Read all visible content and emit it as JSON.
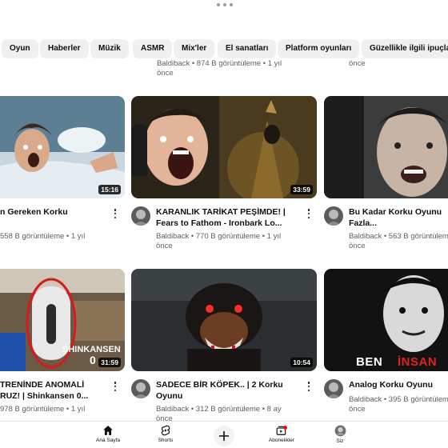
{
  "chips": [
    "Oyun",
    "Haberler",
    "Müzik",
    "ASMR",
    "Mix'ler",
    "El sanatları",
    "Platform oyunları",
    "Güzellikle ilgili ipuçla"
  ],
  "prev_row": {
    "middle_meta_1": "Baldiback • 874 B görüntüleme • 1 yıl",
    "middle_meta_2": "önce",
    "right_meta": "önce"
  },
  "videos": [
    {
      "title_lines": [
        "n Gereken Korku",
        ""
      ],
      "meta_lines": [
        "558 B görüntüleme • 1 yıl",
        ""
      ],
      "duration": "15:16"
    },
    {
      "title_lines": [
        "KARANLIK TARİKAT PEŞİMDE! |",
        "Fears to Fathom - Ironbark Lo..."
      ],
      "meta_lines": [
        "Baldiback • 770 B görüntüleme • 1 yıl",
        "önce"
      ],
      "duration": "33:59"
    },
    {
      "title_lines": [
        "Bu Kadar Korku Oyunu",
        "Fazla..."
      ],
      "meta_lines": [
        "Baldiback • 563 B görüntüleme",
        "önce"
      ],
      "duration": ""
    },
    {
      "title_lines": [
        "TRENİNDE ANOMALİ",
        "RUZ! | Shinkansen 0..."
      ],
      "meta_lines": [
        "978 B görüntüleme • 1 yıl",
        ""
      ],
      "duration": "31:59",
      "thumb_text": [
        "SHINKANSEN",
        "0"
      ]
    },
    {
      "title_lines": [
        "SADECE BİR KÖPEK.. | 2 Korku",
        "Oyunu"
      ],
      "meta_lines": [
        "Baldiback • 312 B görüntüleme • 8 ay",
        "önce"
      ],
      "duration": "10:54"
    },
    {
      "title_lines": [
        "Analog Korku Oyunu",
        ""
      ],
      "meta_lines": [
        "Baldiback • 395 B görüntüleme",
        "önce"
      ],
      "duration": "",
      "thumb_text": [
        "BEN",
        "İNSAN"
      ]
    }
  ],
  "nav": {
    "home": "Ana Sayfa",
    "shorts": "Shorts",
    "subscriptions": "Abonelikler",
    "you": "Siz"
  },
  "colors": {
    "chip_bg": "#f0f0f0",
    "meta_text": "#606060",
    "notification_dot": "#ff0000",
    "thumb_red_text": "#e0231f"
  },
  "icons": [
    "home-icon",
    "shorts-icon",
    "plus-icon",
    "subscriptions-icon",
    "avatar-icon",
    "more-vert-icon"
  ]
}
